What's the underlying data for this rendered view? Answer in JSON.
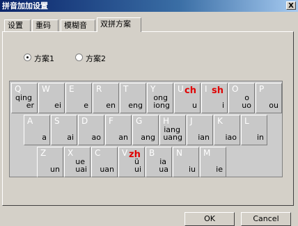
{
  "window": {
    "title": "拼音加加设置",
    "close_label": "X"
  },
  "tabs": [
    {
      "label": "设置"
    },
    {
      "label": "重码"
    },
    {
      "label": "模糊音"
    },
    {
      "label": "双拼方案"
    }
  ],
  "scheme_options": [
    {
      "label": "方案1",
      "selected": true
    },
    {
      "label": "方案2",
      "selected": false
    }
  ],
  "keyboard": {
    "row1": [
      {
        "letter": "Q",
        "lines": [
          "qing",
          "er"
        ]
      },
      {
        "letter": "W",
        "lines": [
          "ei"
        ]
      },
      {
        "letter": "E",
        "lines": [
          "e"
        ]
      },
      {
        "letter": "R",
        "lines": [
          "en"
        ]
      },
      {
        "letter": "T",
        "lines": [
          "eng"
        ]
      },
      {
        "letter": "Y",
        "lines": [
          "ong",
          "iong"
        ]
      },
      {
        "letter": "U",
        "lines": [
          "u"
        ],
        "initial": "ch"
      },
      {
        "letter": "I",
        "lines": [
          "i"
        ],
        "initial": "sh"
      },
      {
        "letter": "O",
        "lines": [
          "o",
          "uo"
        ]
      },
      {
        "letter": "P",
        "lines": [
          "ou"
        ]
      }
    ],
    "row2": [
      {
        "letter": "A",
        "lines": [
          "a"
        ]
      },
      {
        "letter": "S",
        "lines": [
          "ai"
        ]
      },
      {
        "letter": "D",
        "lines": [
          "ao"
        ]
      },
      {
        "letter": "F",
        "lines": [
          "an"
        ]
      },
      {
        "letter": "G",
        "lines": [
          "ang"
        ]
      },
      {
        "letter": "H",
        "lines": [
          "iang",
          "uang"
        ]
      },
      {
        "letter": "J",
        "lines": [
          "ian"
        ]
      },
      {
        "letter": "K",
        "lines": [
          "iao"
        ]
      },
      {
        "letter": "L",
        "lines": [
          "in"
        ]
      }
    ],
    "row3": [
      {
        "letter": "Z",
        "lines": [
          "un"
        ]
      },
      {
        "letter": "X",
        "lines": [
          "ue",
          "uai"
        ]
      },
      {
        "letter": "C",
        "lines": [
          "uan"
        ]
      },
      {
        "letter": "V",
        "lines": [
          "ü",
          "ui"
        ],
        "initial": "zh"
      },
      {
        "letter": "B",
        "lines": [
          "ia",
          "ua"
        ]
      },
      {
        "letter": "N",
        "lines": [
          "iu"
        ]
      },
      {
        "letter": "M",
        "lines": [
          "ie"
        ]
      }
    ]
  },
  "buttons": {
    "ok": "OK",
    "cancel": "Cancel"
  }
}
